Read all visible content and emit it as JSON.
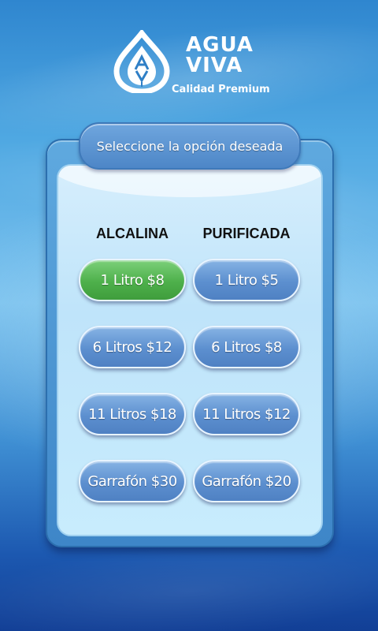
{
  "brand": {
    "name_line1": "AGUA",
    "name_line2": "VIVA",
    "tagline": "Calidad Premium",
    "mark_letters": "AV"
  },
  "panel": {
    "title": "Seleccione la opción deseada"
  },
  "columns": {
    "left_header": "ALCALINA",
    "right_header": "PURIFICADA"
  },
  "options": {
    "alcalina": [
      {
        "label": "1 Litro $8",
        "selected": true
      },
      {
        "label": "6 Litros $12",
        "selected": false
      },
      {
        "label": "11 Litros $18",
        "selected": false
      },
      {
        "label": "Garrafón $30",
        "selected": false
      }
    ],
    "purificada": [
      {
        "label": "1 Litro $5",
        "selected": false
      },
      {
        "label": "6 Litros $8",
        "selected": false
      },
      {
        "label": "11 Litros $12",
        "selected": false
      },
      {
        "label": "Garrafón $20",
        "selected": false
      }
    ]
  },
  "colors": {
    "selected": "#4eb04b",
    "button": "#5c8fcf",
    "background_top": "#2f86cf",
    "background_bottom": "#123f96"
  }
}
